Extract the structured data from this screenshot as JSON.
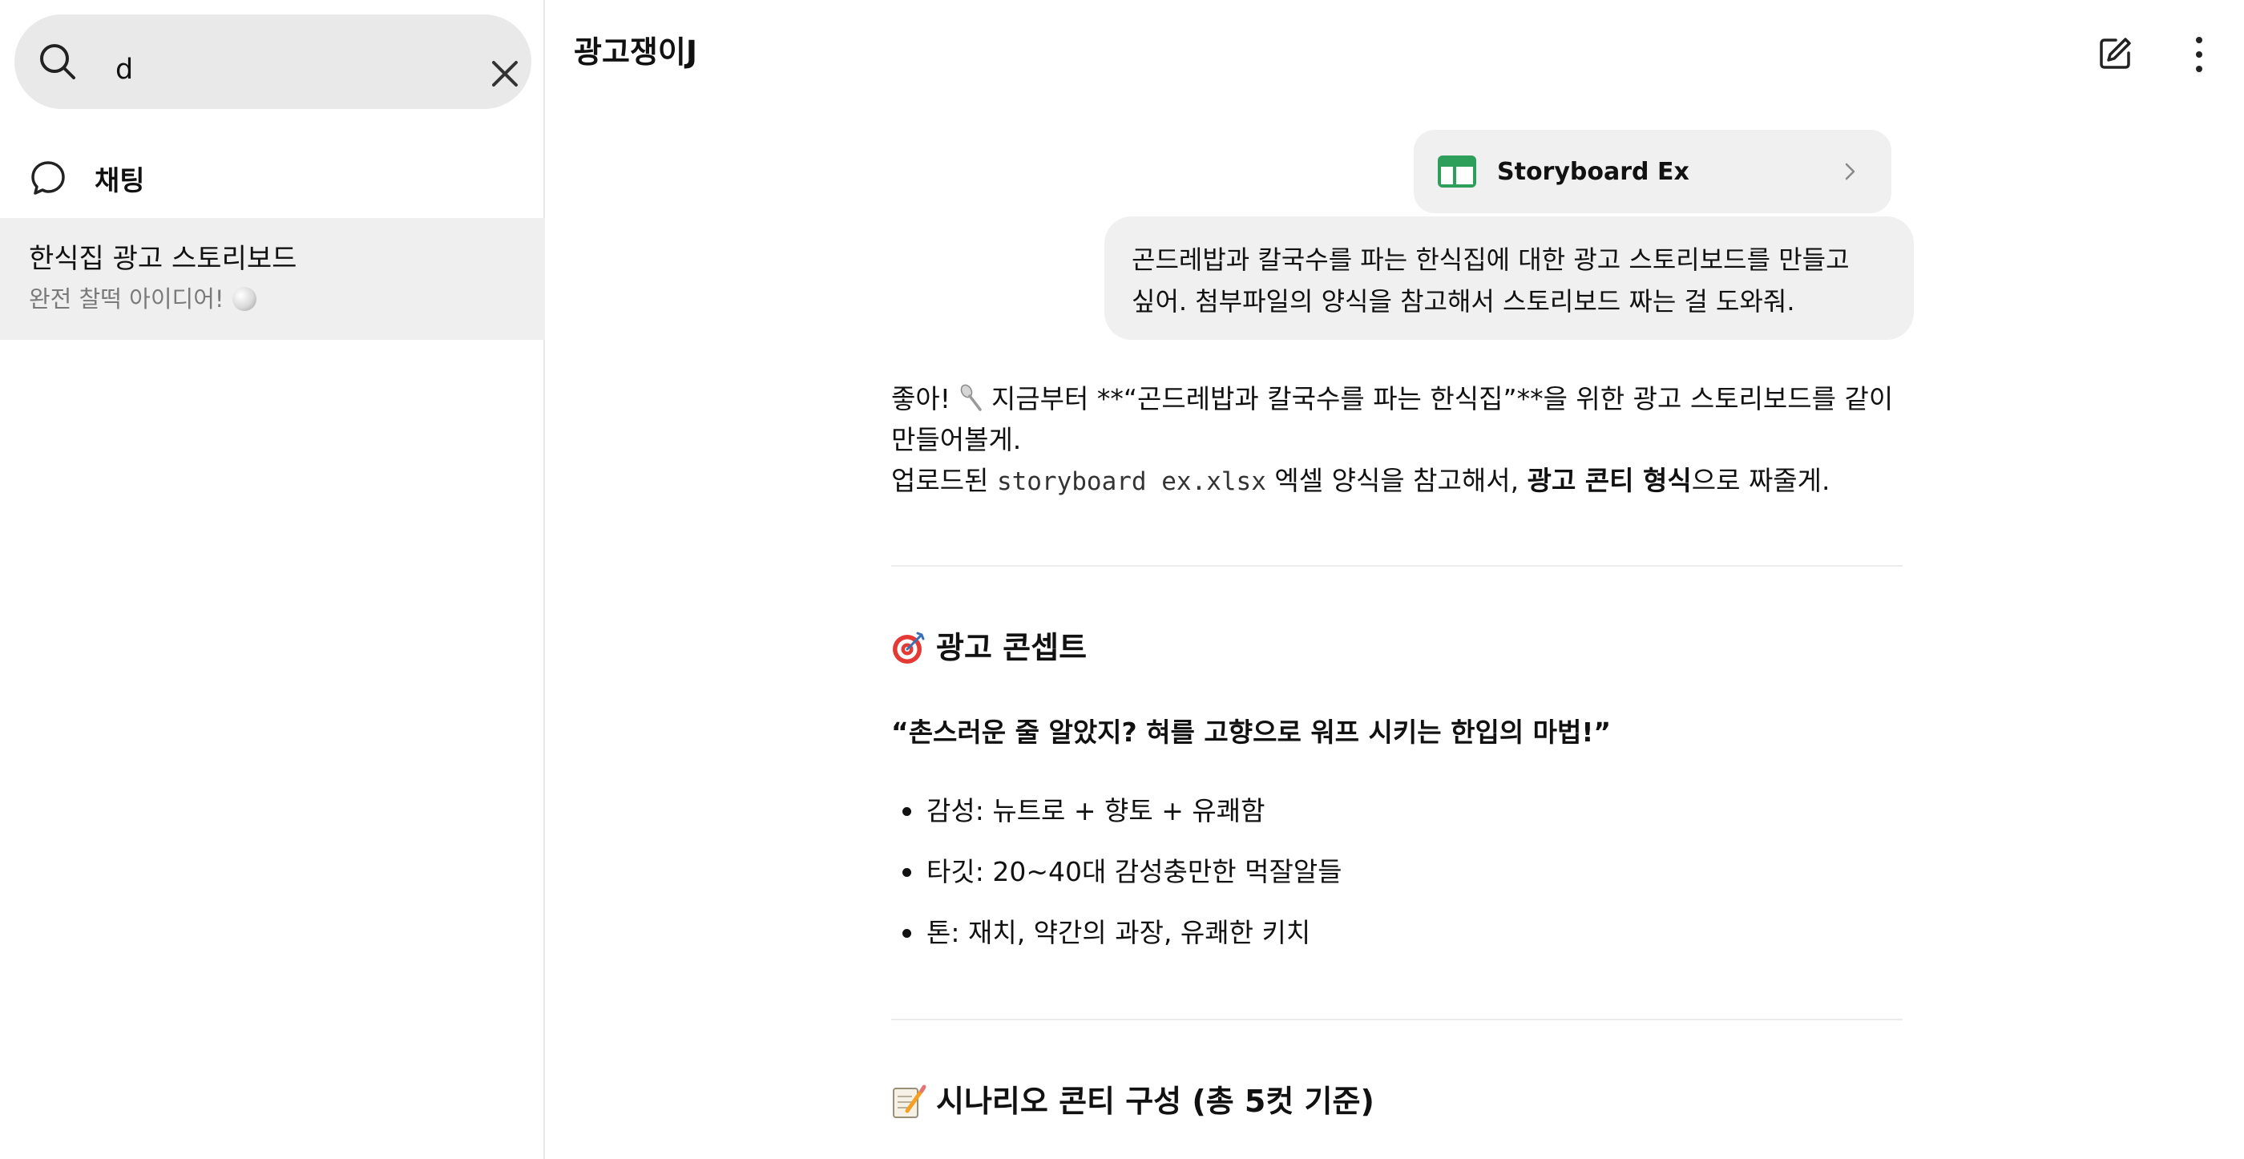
{
  "sidebar": {
    "search_query": "d",
    "section_label": "채팅",
    "result": {
      "title": "한식집 광고 스토리보드",
      "subtitle": "완전 찰떡 아이디어!"
    }
  },
  "header": {
    "title": "광고쟁이J"
  },
  "attachment": {
    "name": "Storyboard Ex"
  },
  "user_message": {
    "line1": "곤드레밥과 칼국수를 파는 한식집에 대한 광고 스토리보드를 만들고",
    "line2": "싶어. 첨부파일의 양식을 참고해서 스토리보드 짜는 걸 도와줘."
  },
  "assistant": {
    "intro_a": "좋아! ",
    "intro_b": " 지금부터 **“곤드레밥과 칼국수를 파는 한식집”**을 위한 광고 스토리보드를 같이 만들어볼게.",
    "upload_pre": "업로드된 ",
    "upload_file": "storyboard ex.xlsx",
    "upload_mid": " 엑셀 양식을 참고해서, ",
    "upload_bold": "광고 콘티 형식",
    "upload_post": "으로 짜줄게.",
    "concept_heading": "광고 콘셉트",
    "slogan": "“촌스러운 줄 알았지? 혀를 고향으로 워프 시키는 한입의 마법!”",
    "bullets": [
      "감성: 뉴트로 + 향토 + 유쾌함",
      "타깃: 20~40대 감성충만한 먹잘알들",
      "톤: 재치, 약간의 과장, 유쾌한 키치"
    ],
    "scenario_heading": "시나리오 콘티 구성 (총 5컷 기준)"
  },
  "colors": {
    "accent_green": "#2e9e5b",
    "sidebar_selected": "#efefef",
    "bubble": "#f0f0f0"
  }
}
